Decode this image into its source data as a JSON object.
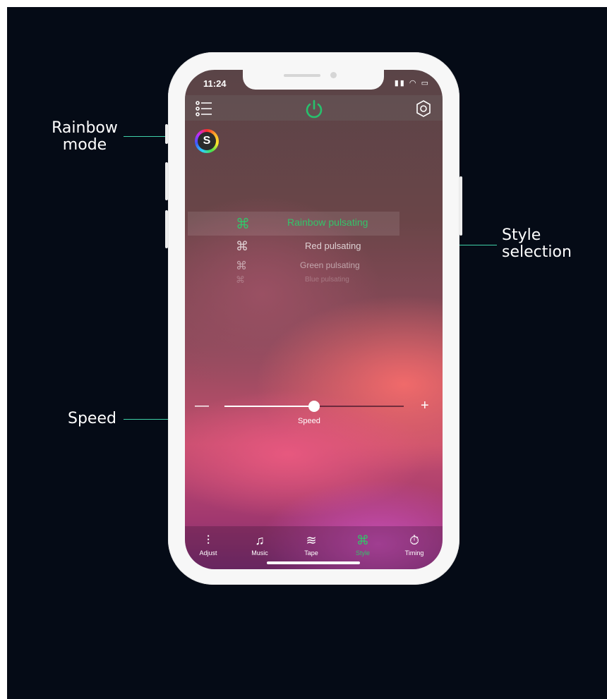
{
  "callouts": {
    "rainbow": "Rainbow\nmode",
    "style": "Style\nselection",
    "speed": "Speed"
  },
  "status": {
    "time": "11:24"
  },
  "rainbow_button": {
    "letter": "S"
  },
  "styles": [
    {
      "label": "Rainbow pulsating",
      "glyph": "⌘",
      "selected": true
    },
    {
      "label": "Red pulsating",
      "glyph": "⌘"
    },
    {
      "label": "Green pulsating",
      "glyph": "⌘"
    },
    {
      "label": "Blue pulsating",
      "glyph": "⌘"
    }
  ],
  "speed": {
    "minus": "—",
    "plus": "+",
    "label": "Speed",
    "value_fraction": 0.5
  },
  "tabs": [
    {
      "label": "Adjust",
      "icon": "⫶"
    },
    {
      "label": "Music",
      "icon": "♫"
    },
    {
      "label": "Tape",
      "icon": "≋"
    },
    {
      "label": "Style",
      "icon": "⌘",
      "active": true
    },
    {
      "label": "Timing",
      "icon": "⏱"
    }
  ],
  "colors": {
    "accent": "#3fd1a8",
    "power_green": "#27c16d",
    "selected_style": "#34c46a"
  }
}
